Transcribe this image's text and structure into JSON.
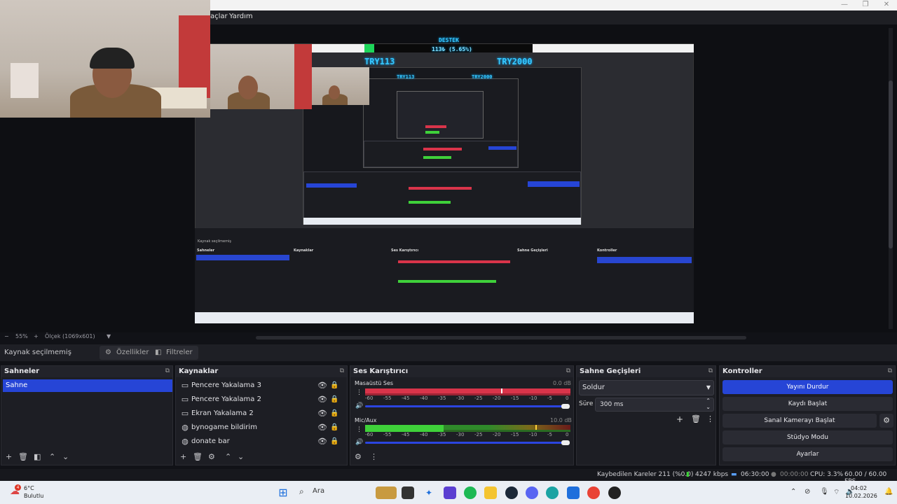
{
  "menu": {
    "tools_partial": "açlar",
    "help": "Yardım"
  },
  "preview": {
    "donation_label": "DESTEK",
    "donation_amount": "113₺ (5.65%)",
    "goal_current": "TRY113",
    "goal_target": "TRY2000",
    "donation_progress_percent": 5.65
  },
  "zoom_row": {
    "zoom": "55%",
    "scale": "Ölçek (1069x601)"
  },
  "source_toolbar": {
    "no_source": "Kaynak seçilmemiş",
    "properties": "Özellikler",
    "filters": "Filtreler"
  },
  "scenes": {
    "title": "Sahneler",
    "items": [
      "Sahne"
    ]
  },
  "sources": {
    "title": "Kaynaklar",
    "items": [
      {
        "label": "Pencere Yakalama 3",
        "icon": "window-icon"
      },
      {
        "label": "Pencere Yakalama 2",
        "icon": "window-icon"
      },
      {
        "label": "Ekran Yakalama 2",
        "icon": "monitor-icon"
      },
      {
        "label": "bynogame bildirim",
        "icon": "globe-icon"
      },
      {
        "label": "donate bar",
        "icon": "globe-icon"
      }
    ]
  },
  "mixer": {
    "title": "Ses Karıştırıcı",
    "ticks": [
      "-60",
      "-55",
      "-45",
      "-40",
      "-35",
      "-30",
      "-25",
      "-20",
      "-15",
      "-10",
      "-5",
      "0"
    ],
    "channels": [
      {
        "name": "Masaüstü Ses",
        "db": "0.0 dB"
      },
      {
        "name": "Mic/Aux",
        "db": "10.0 dB"
      }
    ]
  },
  "transitions": {
    "title": "Sahne Geçişleri",
    "selected": "Soldur",
    "duration_label": "Süre",
    "duration": "300 ms"
  },
  "controls": {
    "title": "Kontroller",
    "stop_stream": "Yayını Durdur",
    "start_record": "Kaydı Başlat",
    "start_vcam": "Sanal Kamerayı Başlat",
    "studio_mode": "Stüdyo Modu",
    "settings": "Ayarlar"
  },
  "status": {
    "dropped_frames": "Kaybedilen Kareler 211 (%0.0)",
    "bitrate": "4247 kbps",
    "stream_time": "06:30:00",
    "record_time": "00:00:00",
    "cpu": "CPU: 3.3%",
    "fps": "60.00 / 60.00 FPS"
  },
  "taskbar": {
    "weather_temp": "6°C",
    "weather_desc": "Bulutlu",
    "weather_badge": "4",
    "search": "Ara",
    "time": "04:02",
    "date": "10.02.2026"
  },
  "colors": {
    "accent": "#2645d6",
    "meter_red": "#d9344a",
    "meter_green": "#3fd13a"
  }
}
